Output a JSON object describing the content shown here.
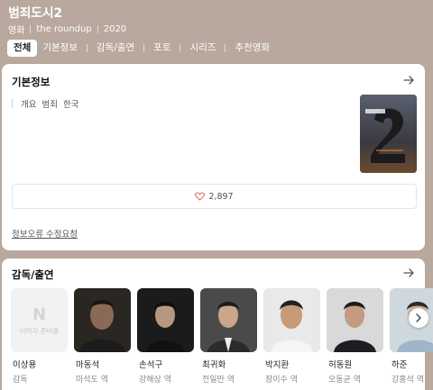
{
  "movie": {
    "title": "범죄도시2",
    "meta": [
      "영화",
      "the roundup",
      "2020"
    ]
  },
  "tabs": [
    {
      "label": "전체",
      "active": true
    },
    {
      "label": "기본정보"
    },
    {
      "label": "감독/출연"
    },
    {
      "label": "포토"
    },
    {
      "label": "시리즈"
    },
    {
      "label": "추천영화"
    }
  ],
  "basic_info": {
    "title": "기본정보",
    "items": [
      "개요",
      "범죄",
      "한국"
    ],
    "likes": "2,897",
    "correction_link": "정보오류 수정요청"
  },
  "cast_section": {
    "title": "감독/출연",
    "no_image_text": "이미지 준비중",
    "no_image_logo": "N",
    "people": [
      {
        "name": "이상용",
        "role": "감독"
      },
      {
        "name": "마동석",
        "role": "마석도 역"
      },
      {
        "name": "손석구",
        "role": "강해상 역"
      },
      {
        "name": "최귀화",
        "role": "전일만 역"
      },
      {
        "name": "박지환",
        "role": "장이수 역"
      },
      {
        "name": "허동원",
        "role": "오동균 역"
      },
      {
        "name": "하준",
        "role": "강홍석 역"
      }
    ]
  },
  "colors": {
    "header_bg": "#b8a89d",
    "heart": "#e0736b"
  }
}
